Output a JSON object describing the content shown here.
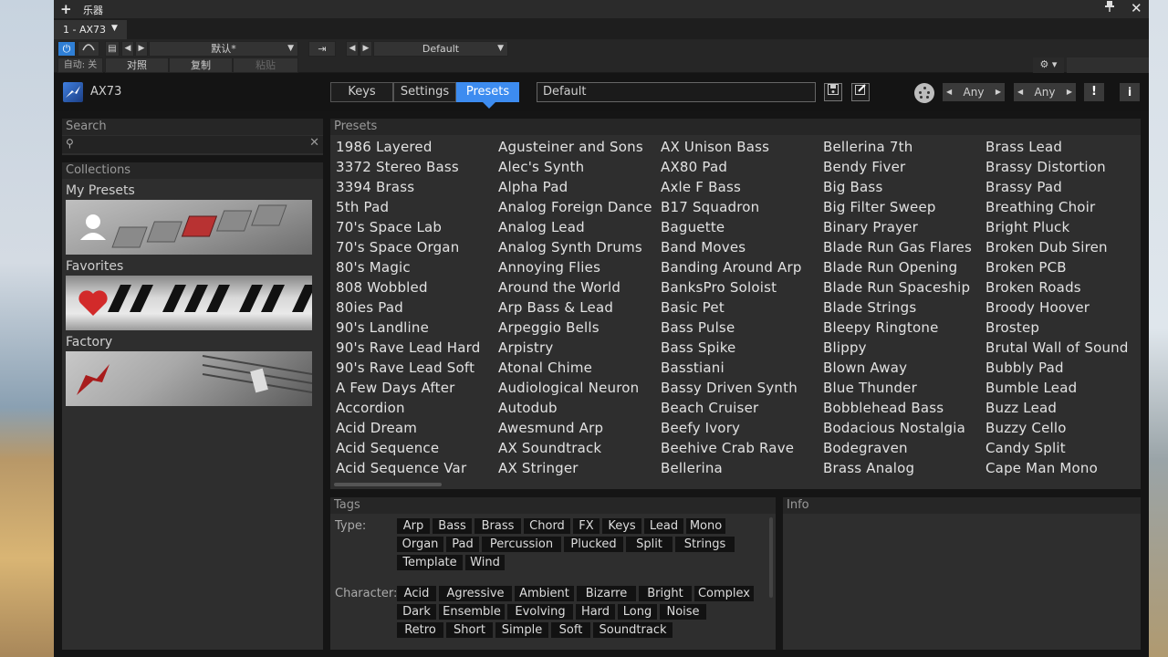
{
  "window": {
    "title": "乐器",
    "pin_icon": "pin-icon",
    "close_icon": "close-icon"
  },
  "instance_tab": {
    "label": "1 - AX73"
  },
  "host_toolbar": {
    "preset_value": "默认*",
    "auto_off": "自动: 关",
    "compare": "对照",
    "copy": "复制",
    "paste": "粘贴",
    "default_value": "Default"
  },
  "plugin": {
    "name": "AX73",
    "tabs": [
      "Keys",
      "Settings",
      "Presets"
    ],
    "active_tab": "Presets",
    "preset_name": "Default",
    "filter1": "Any",
    "filter2": "Any",
    "warn_label": "!",
    "info_label": "i",
    "accent_color": "#3d8cf0"
  },
  "search": {
    "header": "Search",
    "placeholder": ""
  },
  "collections": {
    "header": "Collections",
    "items": [
      {
        "label": "My Presets"
      },
      {
        "label": "Favorites"
      },
      {
        "label": "Factory"
      }
    ]
  },
  "presets": {
    "header": "Presets",
    "columns": [
      [
        "1986 Layered",
        "3372 Stereo Bass",
        "3394 Brass",
        "5th Pad",
        "70's Space Lab",
        "70's Space Organ",
        "80's Magic",
        "808 Wobbled",
        "80ies Pad",
        "90's Landline",
        "90's Rave Lead Hard",
        "90's Rave Lead Soft",
        "A Few Days After",
        "Accordion",
        "Acid Dream",
        "Acid Sequence",
        "Acid Sequence Var"
      ],
      [
        "Agusteiner and Sons",
        "Alec's Synth",
        "Alpha Pad",
        "Analog Foreign Dance",
        "Analog Lead",
        "Analog Synth Drums",
        "Annoying Flies",
        "Around the World",
        "Arp Bass & Lead",
        "Arpeggio Bells",
        "Arpistry",
        "Atonal Chime",
        "Audiological Neuron",
        "Autodub",
        "Awesmund Arp",
        "AX Soundtrack",
        "AX Stringer"
      ],
      [
        "AX Unison Bass",
        "AX80 Pad",
        "Axle F Bass",
        "B17 Squadron",
        "Baguette",
        "Band Moves",
        "Banding Around Arp",
        "BanksPro Soloist",
        "Basic Pet",
        "Bass Pulse",
        "Bass Spike",
        "Basstiani",
        "Bassy Driven Synth",
        "Beach Cruiser",
        "Beefy Ivory",
        "Beehive Crab Rave",
        "Bellerina"
      ],
      [
        "Bellerina 7th",
        "Bendy Fiver",
        "Big Bass",
        "Big Filter Sweep",
        "Binary Prayer",
        "Blade Run Gas Flares",
        "Blade Run Opening",
        "Blade Run Spaceship",
        "Blade Strings",
        "Bleepy Ringtone",
        "Blippy",
        "Blown Away",
        "Blue Thunder",
        "Bobblehead Bass",
        "Bodacious Nostalgia",
        "Bodegraven",
        "Brass Analog"
      ],
      [
        "Brass Lead",
        "Brassy Distortion",
        "Brassy Pad",
        "Breathing Choir",
        "Bright Pluck",
        "Broken Dub Siren",
        "Broken PCB",
        "Broken Roads",
        "Broody Hoover",
        "Brostep",
        "Brutal Wall of Sound",
        "Bubbly Pad",
        "Bumble Lead",
        "Buzz Lead",
        "Buzzy Cello",
        "Candy Split",
        "Cape Man Mono"
      ]
    ]
  },
  "tags": {
    "header": "Tags",
    "type_label": "Type:",
    "character_label": "Character:",
    "type": [
      "Arp",
      "Bass",
      "Brass",
      "Chord",
      "FX",
      "Keys",
      "Lead",
      "Mono",
      "Organ",
      "Pad",
      "Percussion",
      "Plucked",
      "Split",
      "Strings",
      "Template",
      "Wind"
    ],
    "character": [
      "Acid",
      "Agressive",
      "Ambient",
      "Bizarre",
      "Bright",
      "Complex",
      "Dark",
      "Ensemble",
      "Evolving",
      "Hard",
      "Long",
      "Noise",
      "Retro",
      "Short",
      "Simple",
      "Soft",
      "Soundtrack"
    ]
  },
  "info": {
    "header": "Info"
  }
}
